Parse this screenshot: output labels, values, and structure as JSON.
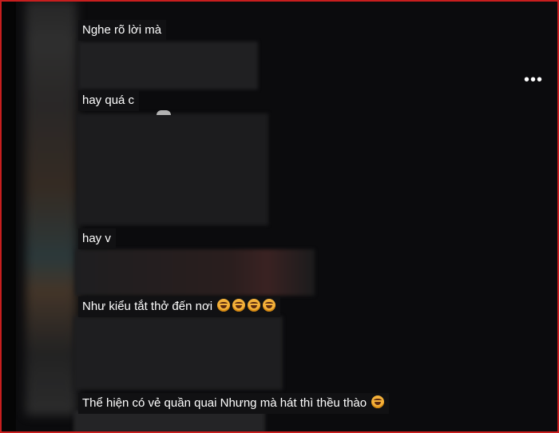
{
  "comments": [
    {
      "text": "Nghe rõ lời mà",
      "emoji_count": 0
    },
    {
      "text": "hay quá c",
      "emoji_count": 0
    },
    {
      "text": "hay v",
      "emoji_count": 0
    },
    {
      "text": "Như kiểu tắt thở đến nơi",
      "emoji_count": 4
    },
    {
      "text": "Thể hiện có vẻ quần quai Nhưng mà hát thì thều thào",
      "emoji_count": 1
    }
  ],
  "menu": {
    "more_label": "•••"
  },
  "icons": {
    "emoji": "laughing-face-emoji",
    "more": "more-options-icon"
  },
  "colors": {
    "frame": "#c81e1e",
    "comment_bg": "#111113",
    "text": "#ffffff",
    "page_bg": "#0b0b0d"
  }
}
